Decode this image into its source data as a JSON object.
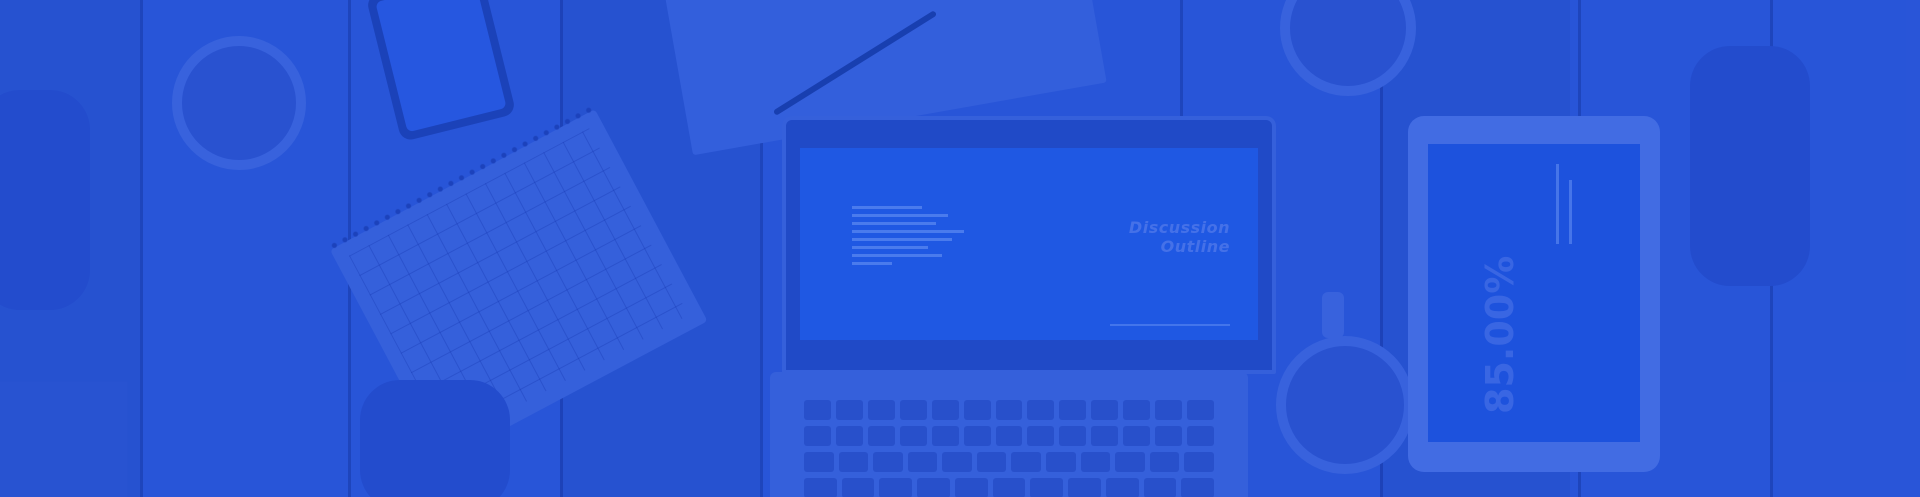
{
  "hero": {
    "laptop_slide": {
      "title_line1": "Discussion",
      "title_line2": "Outline"
    },
    "tablet_slide": {
      "value": "85.00%"
    },
    "colors": {
      "overlay": "#2452d6",
      "screen": "#1f5ae6",
      "highlight": "#4d78ec"
    }
  }
}
